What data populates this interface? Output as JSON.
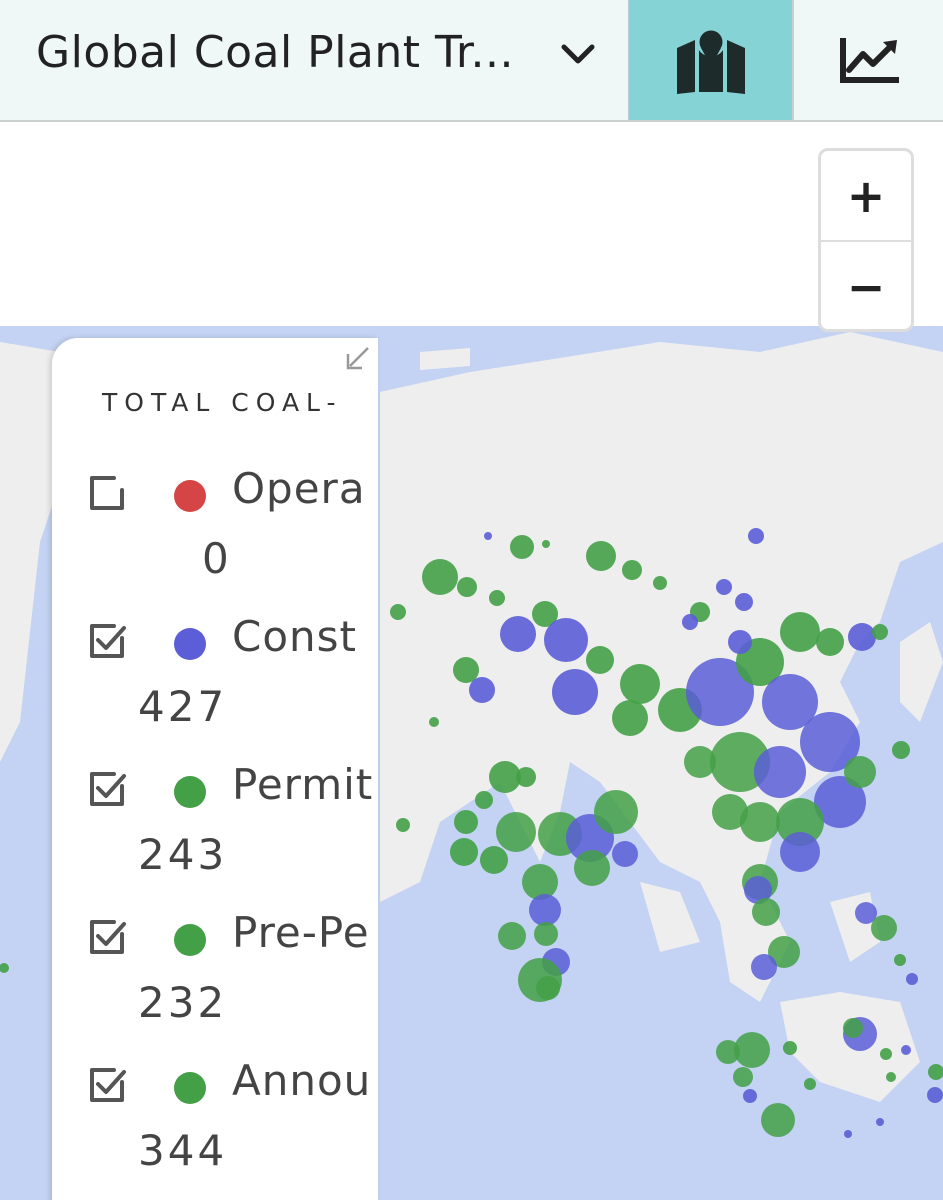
{
  "header": {
    "title": "Global Coal Plant Tr...",
    "map_tab_icon": "map-pin-icon",
    "trends_tab_icon": "trend-chart-icon",
    "active_tab_color": "#86d3d6"
  },
  "zoom": {
    "in_label": "+",
    "out_label": "−"
  },
  "legend": {
    "title": "TOTAL COAL-",
    "items": [
      {
        "label": "Opera",
        "count": "0",
        "color": "#d64545",
        "checked": false
      },
      {
        "label": "Const",
        "count": "427",
        "color": "#5b5ed6",
        "checked": true
      },
      {
        "label": "Permit",
        "count": "243",
        "color": "#43a047",
        "checked": true
      },
      {
        "label": "Pre-Pe",
        "count": "232",
        "color": "#43a047",
        "checked": true
      },
      {
        "label": "Annou",
        "count": "344",
        "color": "#43a047",
        "checked": true
      }
    ]
  },
  "map": {
    "water_color": "#c4d3f3",
    "land_color": "#eeeeee",
    "green": "#43a047",
    "blue": "#5b5ed6"
  }
}
